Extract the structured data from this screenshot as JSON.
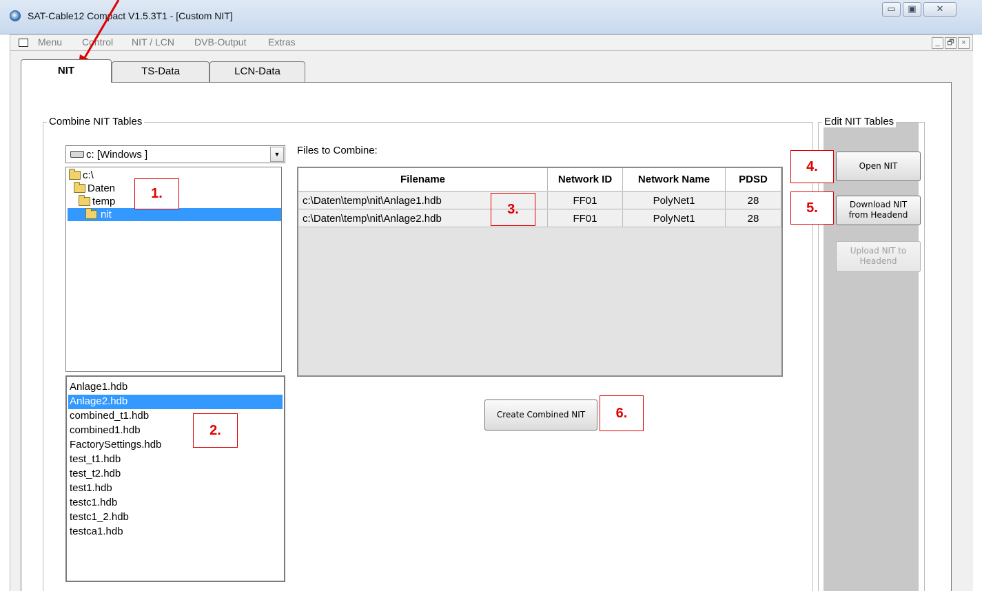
{
  "window": {
    "title": "SAT-Cable12 Compact V1.5.3T1 - [Custom NIT]",
    "controls": {
      "minimize": "▭",
      "maximize": "▣",
      "close": "✕"
    }
  },
  "menubar": {
    "items": [
      "Menu",
      "Control",
      "NIT / LCN",
      "DVB-Output",
      "Extras"
    ],
    "mdi_controls": {
      "minimize": "_",
      "restore": "🗗",
      "close": "×"
    }
  },
  "tabs": [
    {
      "label": "NIT",
      "active": true
    },
    {
      "label": "TS-Data",
      "active": false
    },
    {
      "label": "LCN-Data",
      "active": false
    }
  ],
  "combine_group": {
    "label": "Combine NIT Tables",
    "drive_select": {
      "value": "c: [Windows ]",
      "icon": "drive-icon"
    },
    "directories": [
      {
        "label": "c:\\",
        "selected": false
      },
      {
        "label": "Daten",
        "selected": false
      },
      {
        "label": "temp",
        "selected": false
      },
      {
        "label": "nit",
        "selected": true
      }
    ],
    "files": [
      {
        "name": "Anlage1.hdb",
        "selected": false
      },
      {
        "name": "Anlage2.hdb",
        "selected": true
      },
      {
        "name": "combined_t1.hdb",
        "selected": false
      },
      {
        "name": "combined1.hdb",
        "selected": false
      },
      {
        "name": "FactorySettings.hdb",
        "selected": false
      },
      {
        "name": "test_t1.hdb",
        "selected": false
      },
      {
        "name": "test_t2.hdb",
        "selected": false
      },
      {
        "name": "test1.hdb",
        "selected": false
      },
      {
        "name": "testc1.hdb",
        "selected": false
      },
      {
        "name": "testc1_2.hdb",
        "selected": false
      },
      {
        "name": "testca1.hdb",
        "selected": false
      }
    ],
    "files_label": "Files to Combine:",
    "table": {
      "columns": [
        "Filename",
        "Network ID",
        "Network Name",
        "PDSD"
      ],
      "rows": [
        [
          "c:\\Daten\\temp\\nit\\Anlage1.hdb",
          "FF01",
          "PolyNet1",
          "28"
        ],
        [
          "c:\\Daten\\temp\\nit\\Anlage2.hdb",
          "FF01",
          "PolyNet1",
          "28"
        ]
      ]
    },
    "create_button": "Create Combined NIT"
  },
  "edit_group": {
    "label": "Edit NIT Tables",
    "open_button": "Open NIT",
    "download_button": [
      "Download NIT",
      "from Headend"
    ],
    "upload_button": [
      "Upload NIT to",
      "Headend"
    ],
    "upload_enabled": false
  },
  "annotations": [
    "1.",
    "2.",
    "3.",
    "4.",
    "5.",
    "6."
  ],
  "colors": {
    "selection": "#3399ff",
    "annotation": "#e00000",
    "panel": "#c8c8c8"
  }
}
